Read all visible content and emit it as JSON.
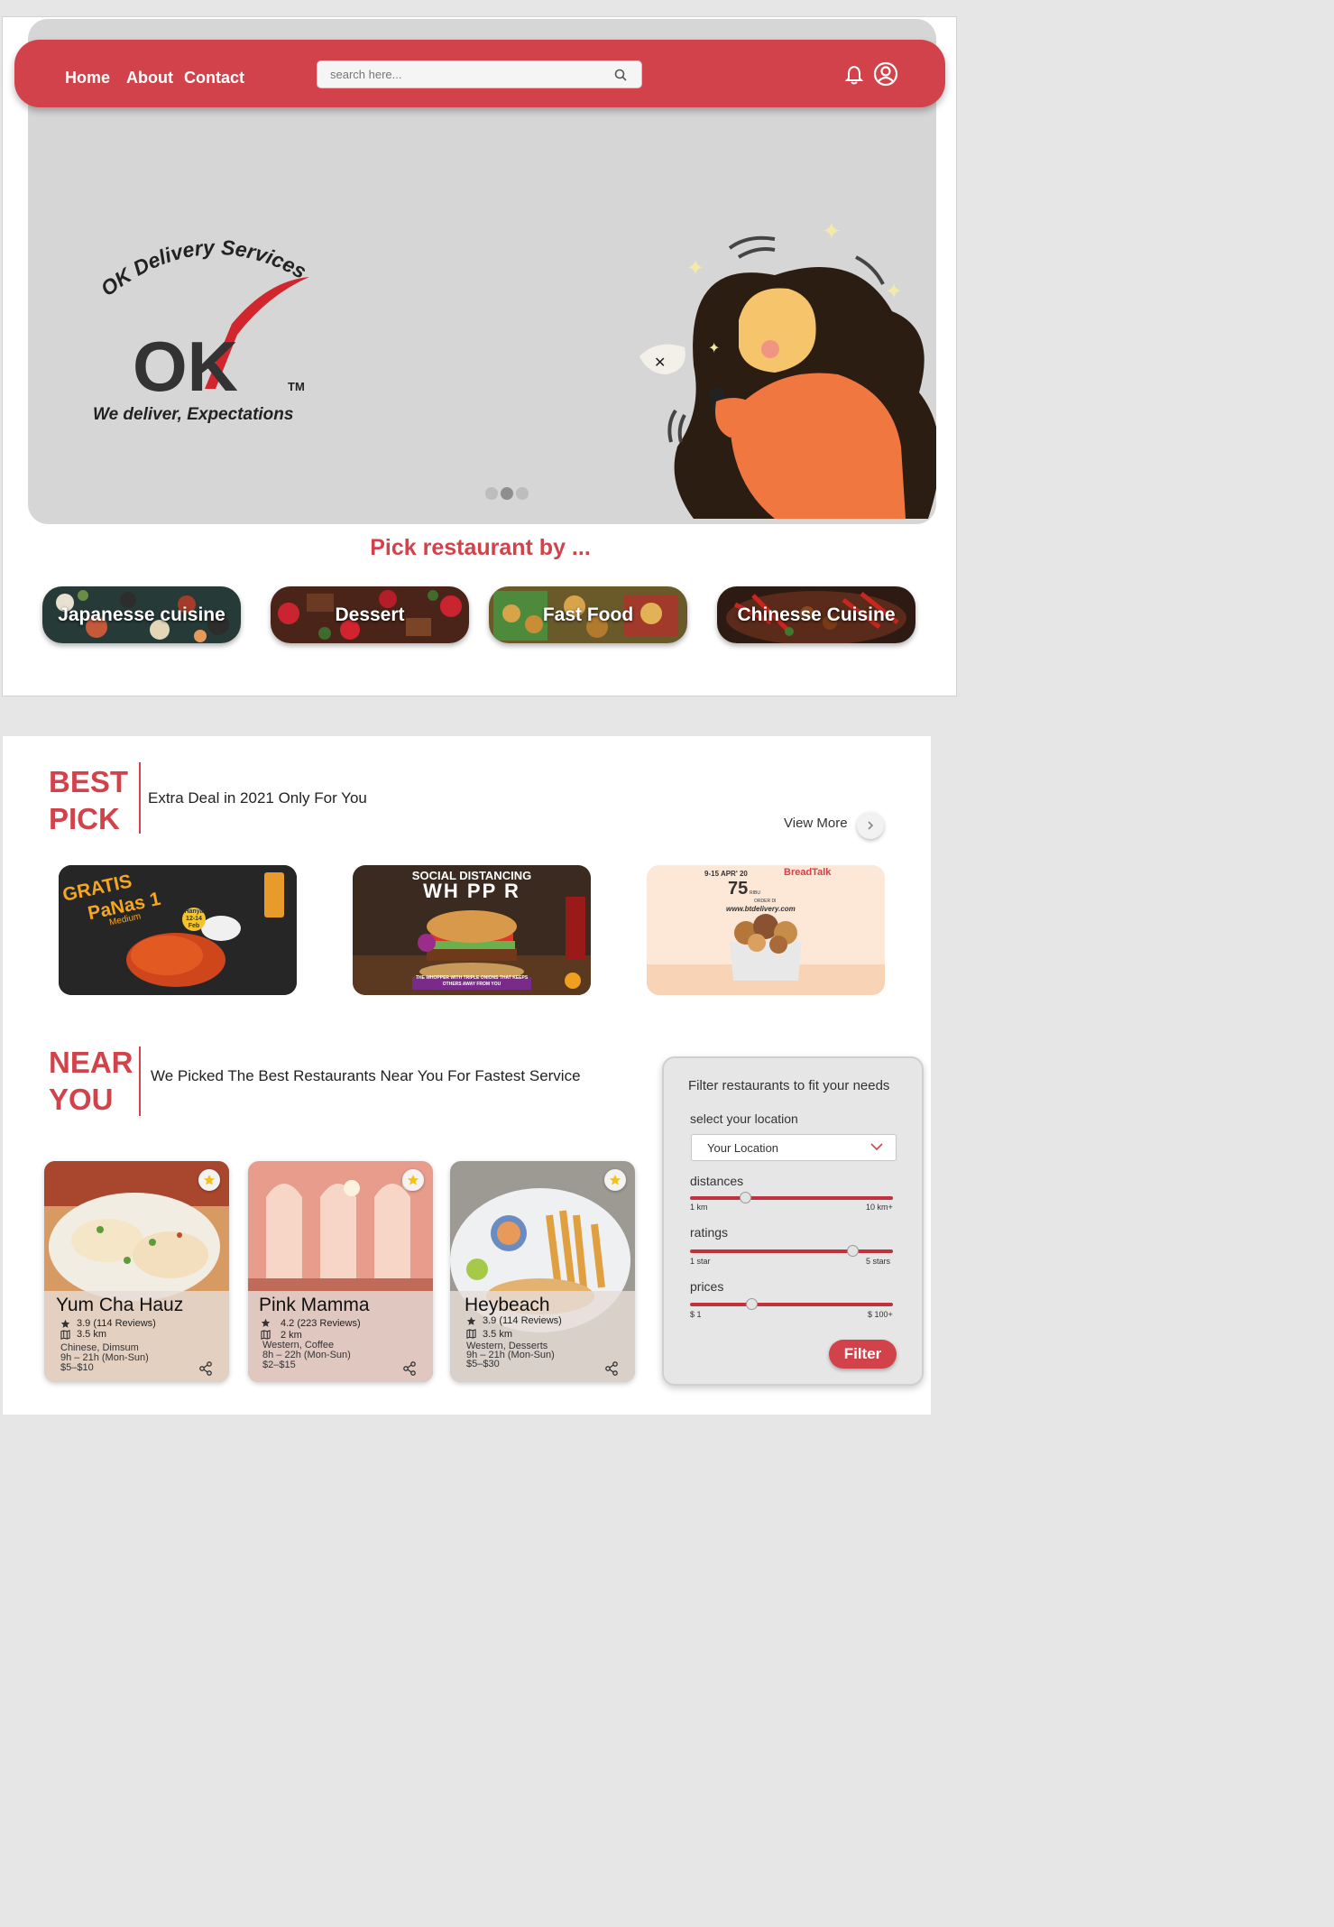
{
  "nav": {
    "links": [
      "Home",
      "About",
      "Contact"
    ],
    "search_placeholder": "search here..."
  },
  "hero": {
    "brand_top": "OK Delivery Services",
    "logo_text": "OK",
    "tm": "TM",
    "tagline": "We deliver, Expectations",
    "slide_count": 3,
    "active_slide": 2
  },
  "pick": {
    "title": "Pick restaurant by ...",
    "categories": [
      "Japanesse cuisine",
      "Dessert",
      "Fast Food",
      "Chinesse Cuisine"
    ]
  },
  "best_pick": {
    "title_line1": "BEST",
    "title_line2": "PICK",
    "subtitle": "Extra Deal in 2021 Only For You",
    "view_more": "View More",
    "promos": [
      {
        "line1": "GRATIS",
        "line2": "PaNas 1",
        "line3": "Medium",
        "badge": "Hanya 12-14 Feb"
      },
      {
        "line1": "SOCIAL DISTANCING",
        "line2": "WH PP R",
        "line3": "THE WHOPPER WITH TRIPLE ONIONS THAT KEEPS OTHERS AWAY FROM YOU"
      },
      {
        "line1": "9-15 APR' 20",
        "line2": "75",
        "line3": "www.btdelivery.com",
        "brand": "BreadTalk",
        "unit": "RIBU",
        "order": "ORDER DI"
      }
    ]
  },
  "near_you": {
    "title_line1": "NEAR",
    "title_line2": "YOU",
    "subtitle": "We Picked The Best Restaurants Near You For Fastest Service",
    "restaurants": [
      {
        "name": "Yum Cha Hauz",
        "rating": "3.9 (114 Reviews)",
        "distance": "3.5 km",
        "cuisine": "Chinese, Dimsum",
        "hours": "9h – 21h (Mon-Sun)",
        "price": "$5–$10"
      },
      {
        "name": "Pink Mamma",
        "rating": "4.2 (223 Reviews)",
        "distance": "2 km",
        "cuisine": "Western, Coffee",
        "hours": "8h – 22h (Mon-Sun)",
        "price": "$2–$15"
      },
      {
        "name": "Heybeach",
        "rating": "3.9 (114 Reviews)",
        "distance": "3.5 km",
        "cuisine": "Western, Desserts",
        "hours": "9h – 21h (Mon-Sun)",
        "price": "$5–$30"
      }
    ]
  },
  "filter": {
    "title": "Filter restaurants to fit your needs",
    "location_label": "select your location",
    "location_value": "Your Location",
    "sliders": [
      {
        "label": "distances",
        "min": "1 km",
        "max": "10 km+",
        "value": 0.27
      },
      {
        "label": "ratings",
        "min": "1 star",
        "max": "5 stars",
        "value": 0.8
      },
      {
        "label": "prices",
        "min": "$ 1",
        "max": "$ 100+",
        "value": 0.3
      }
    ],
    "button": "Filter"
  },
  "colors": {
    "accent": "#d2424a",
    "hero_bg": "#d6d6d6",
    "panel_bg": "#e6e6e6"
  }
}
